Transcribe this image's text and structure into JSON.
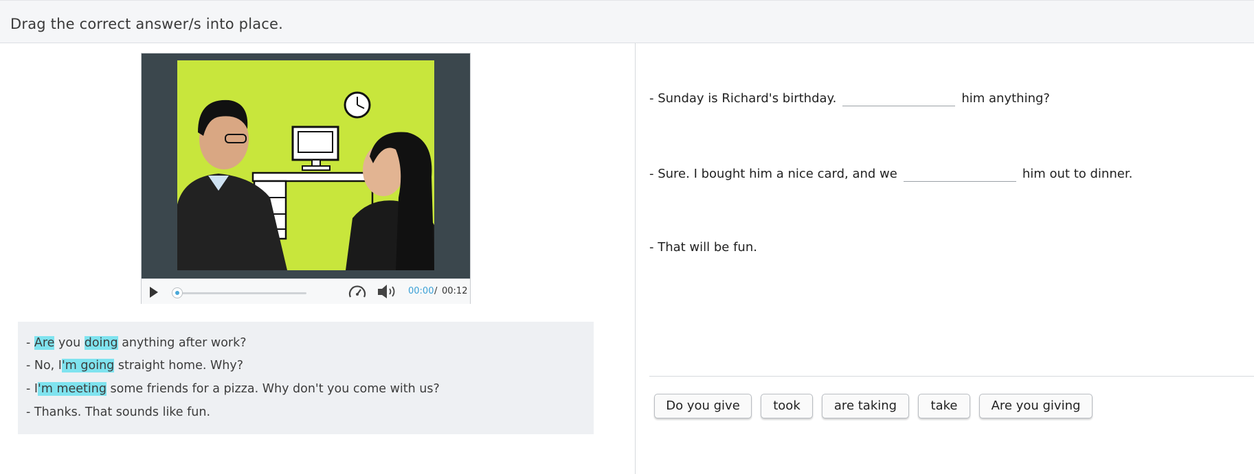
{
  "header": {
    "instruction": "Drag the correct answer/s into place."
  },
  "player": {
    "time_current": "00:00",
    "time_separator": "/",
    "time_total": "00:12",
    "progress_fraction": 0,
    "icons": [
      "play-icon",
      "speed-icon",
      "volume-icon"
    ]
  },
  "transcript": {
    "lines": [
      {
        "segments": [
          {
            "text": "- ",
            "hl": false
          },
          {
            "text": "Are",
            "hl": true
          },
          {
            "text": " you ",
            "hl": false
          },
          {
            "text": "doing",
            "hl": true
          },
          {
            "text": " anything after work?",
            "hl": false
          }
        ]
      },
      {
        "segments": [
          {
            "text": "- No, I",
            "hl": false
          },
          {
            "text": "'m going",
            "hl": true
          },
          {
            "text": " straight home. Why?",
            "hl": false
          }
        ]
      },
      {
        "segments": [
          {
            "text": "- I",
            "hl": false
          },
          {
            "text": "'m meeting",
            "hl": true
          },
          {
            "text": " some friends for a pizza. Why don't you come with us?",
            "hl": false
          }
        ]
      },
      {
        "segments": [
          {
            "text": "- Thanks. That sounds like fun.",
            "hl": false
          }
        ]
      }
    ],
    "highlight_color": "#7fe3ef"
  },
  "exercise": {
    "q1": {
      "before": "- Sunday is Richard's birthday.",
      "after": "him anything?"
    },
    "q2": {
      "before": "- Sure. I bought him a nice card, and we",
      "after": "him out to dinner."
    },
    "q3": {
      "text": "- That will be fun."
    }
  },
  "answers": [
    "Do you give",
    "took",
    "are taking",
    "take",
    "Are you giving"
  ],
  "colors": {
    "accent": "#3aa0d6",
    "video_bg": "#c8e63c",
    "player_frame": "#3b474d"
  }
}
